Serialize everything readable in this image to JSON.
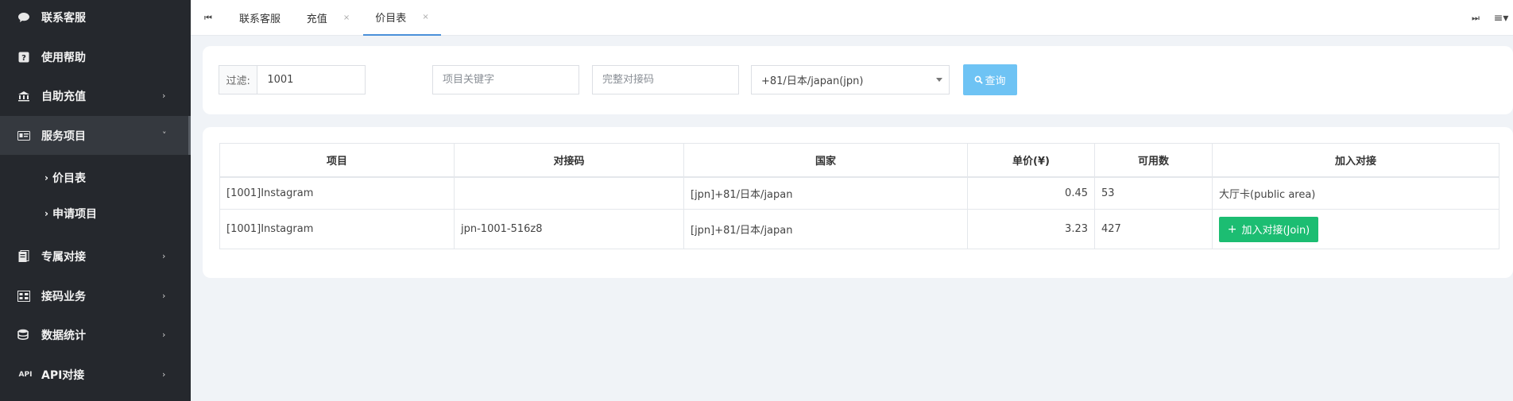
{
  "sidebar": {
    "items": [
      {
        "label": "联系客服",
        "icon": "chat-icon"
      },
      {
        "label": "使用帮助",
        "icon": "help-icon"
      },
      {
        "label": "自助充值",
        "icon": "bank-icon",
        "arrow": "›"
      },
      {
        "label": "服务项目",
        "icon": "id-card-icon",
        "arrow": "˅"
      },
      {
        "label": "专属对接",
        "icon": "document-icon",
        "arrow": "›"
      },
      {
        "label": "接码业务",
        "icon": "grid-icon",
        "arrow": "›"
      },
      {
        "label": "数据统计",
        "icon": "database-icon",
        "arrow": "›"
      },
      {
        "label": "API对接",
        "icon": "api-icon",
        "icon_text": "API",
        "arrow": "›"
      }
    ],
    "sub_items": [
      {
        "label": "价目表",
        "arrow": "›"
      },
      {
        "label": "申请项目",
        "arrow": "›"
      }
    ]
  },
  "tabbar": {
    "prev_icon": "⏮",
    "next_icon": "⏭",
    "menu_icon": "≡▾",
    "tabs": [
      {
        "label": "联系客服",
        "closable": false
      },
      {
        "label": "充值",
        "closable": true
      },
      {
        "label": "价目表",
        "closable": true,
        "active": true
      }
    ],
    "close_glyph": "×"
  },
  "filter": {
    "label": "过滤:",
    "filter_value": "1001",
    "keyword_placeholder": "项目关键字",
    "code_placeholder": "完整对接码",
    "country_selected": "+81/日本/japan(jpn)",
    "query_label": "查询"
  },
  "table": {
    "headers": [
      "项目",
      "对接码",
      "国家",
      "单价(¥)",
      "可用数",
      "加入对接"
    ],
    "rows": [
      {
        "project": "[1001]Instagram",
        "code": "",
        "country": "[jpn]+81/日本/japan",
        "price": "0.45",
        "available": "53",
        "join": "大厅卡(public area)"
      },
      {
        "project": "[1001]Instagram",
        "code": "jpn-1001-516z8",
        "country": "[jpn]+81/日本/japan",
        "price": "3.23",
        "available": "427",
        "join_button": "加入对接(Join)"
      }
    ]
  },
  "colors": {
    "sidebar_bg": "#25282d",
    "query_button": "#6ec3f4",
    "join_button": "#1cbd72",
    "price_text": "#1a9a2c"
  }
}
